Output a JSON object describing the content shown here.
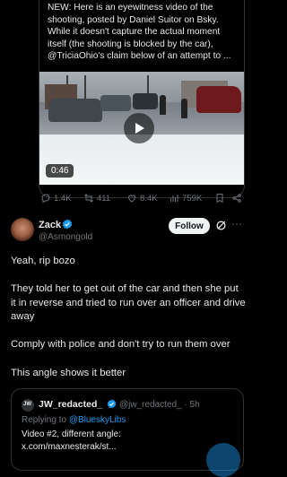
{
  "quoted_post": {
    "text": "NEW: Here is an eyewitness video of the shooting, posted by Daniel Suitor on Bsky. While it doesn't capture the actual moment itself (the shooting is blocked by the car), @TriciaOhio's claim below of an attempt to ...",
    "video_duration": "0:46"
  },
  "actions": {
    "replies": "1.4K",
    "reposts": "411",
    "likes": "8.4K",
    "views": "759K"
  },
  "reply": {
    "author_name": "Zack",
    "author_handle": "@Asmongold",
    "follow_label": "Follow",
    "paragraphs": [
      "Yeah, rip bozo",
      "They told her to get out of the car and then she put it in reverse and tried to run over an officer and drive away",
      "Comply with police and don't try to run them over",
      "This angle shows it better"
    ]
  },
  "embedded_quote": {
    "author_name": "JW_redacted_",
    "author_handle": "@jw_redacted_",
    "separator": "·",
    "time": "5h",
    "replying_prefix": "Replying to",
    "replying_to": "@BlueskyLibs",
    "body_line1": "Video #2, different angle:",
    "body_line2": "x.com/maxnesterak/st...",
    "avatar_text": "JW"
  },
  "colors": {
    "background": "#000000",
    "text": "#e7e9ea",
    "muted": "#71767b",
    "accent": "#1d9bf0",
    "border": "#2f3336"
  },
  "icons": [
    "reply-icon",
    "repost-icon",
    "like-icon",
    "views-icon",
    "bookmark-icon",
    "share-icon",
    "verified-badge-icon",
    "grok-icon",
    "more-icon",
    "play-icon"
  ]
}
